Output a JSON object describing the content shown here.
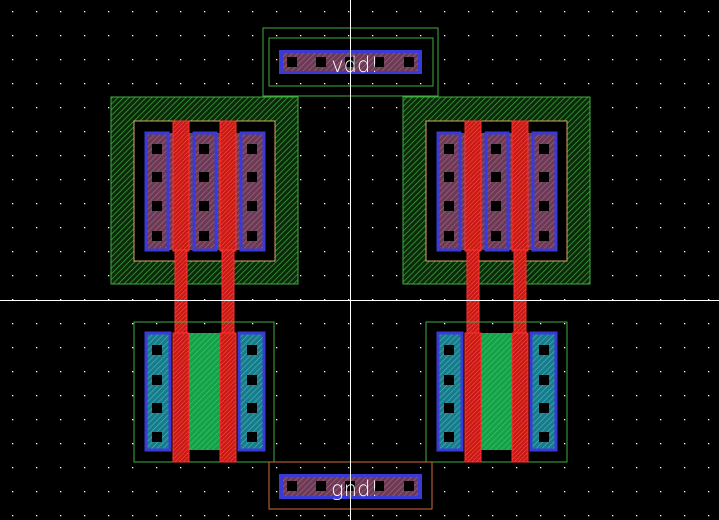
{
  "layout_view": {
    "pin_labels": {
      "vdd": "vdd!",
      "gnd": "gnd!"
    },
    "colors": {
      "background": "#000000",
      "grid_dot": "#ffffff",
      "crosshair": "#ffffff",
      "nwell": "#3fae3f",
      "pselect": "#d8a860",
      "poly": "#ff2a2a",
      "active_p": "#8a4a6a",
      "active_n": "#2aa0a8",
      "active_n_mid": "#1fbf5a",
      "contact": "#000000",
      "metal1": "#3a3ad8",
      "label_text": "#ffffff",
      "gnd_outline": "#d06a3a",
      "vdd_outline": "#3fae3f"
    }
  }
}
